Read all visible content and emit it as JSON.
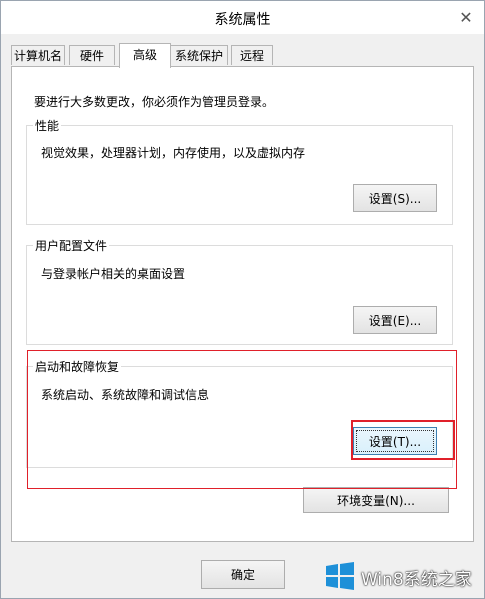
{
  "window": {
    "title": "系统属性"
  },
  "tabs": [
    {
      "label": "计算机名"
    },
    {
      "label": "硬件"
    },
    {
      "label": "高级",
      "active": true
    },
    {
      "label": "系统保护"
    },
    {
      "label": "远程"
    }
  ],
  "panel": {
    "intro": "要进行大多数更改，你必须作为管理员登录。",
    "performance": {
      "title": "性能",
      "desc": "视觉效果，处理器计划，内存使用，以及虚拟内存",
      "button": "设置(S)..."
    },
    "user_profiles": {
      "title": "用户配置文件",
      "desc": "与登录帐户相关的桌面设置",
      "button": "设置(E)..."
    },
    "startup_recovery": {
      "title": "启动和故障恢复",
      "desc": "系统启动、系统故障和调试信息",
      "button": "设置(T)..."
    },
    "env_button": "环境变量(N)..."
  },
  "footer": {
    "ok": "确定"
  },
  "watermark": {
    "text": "Win8系统之家"
  },
  "colors": {
    "highlight": "#e0202a",
    "logo": "#1e90d8"
  }
}
